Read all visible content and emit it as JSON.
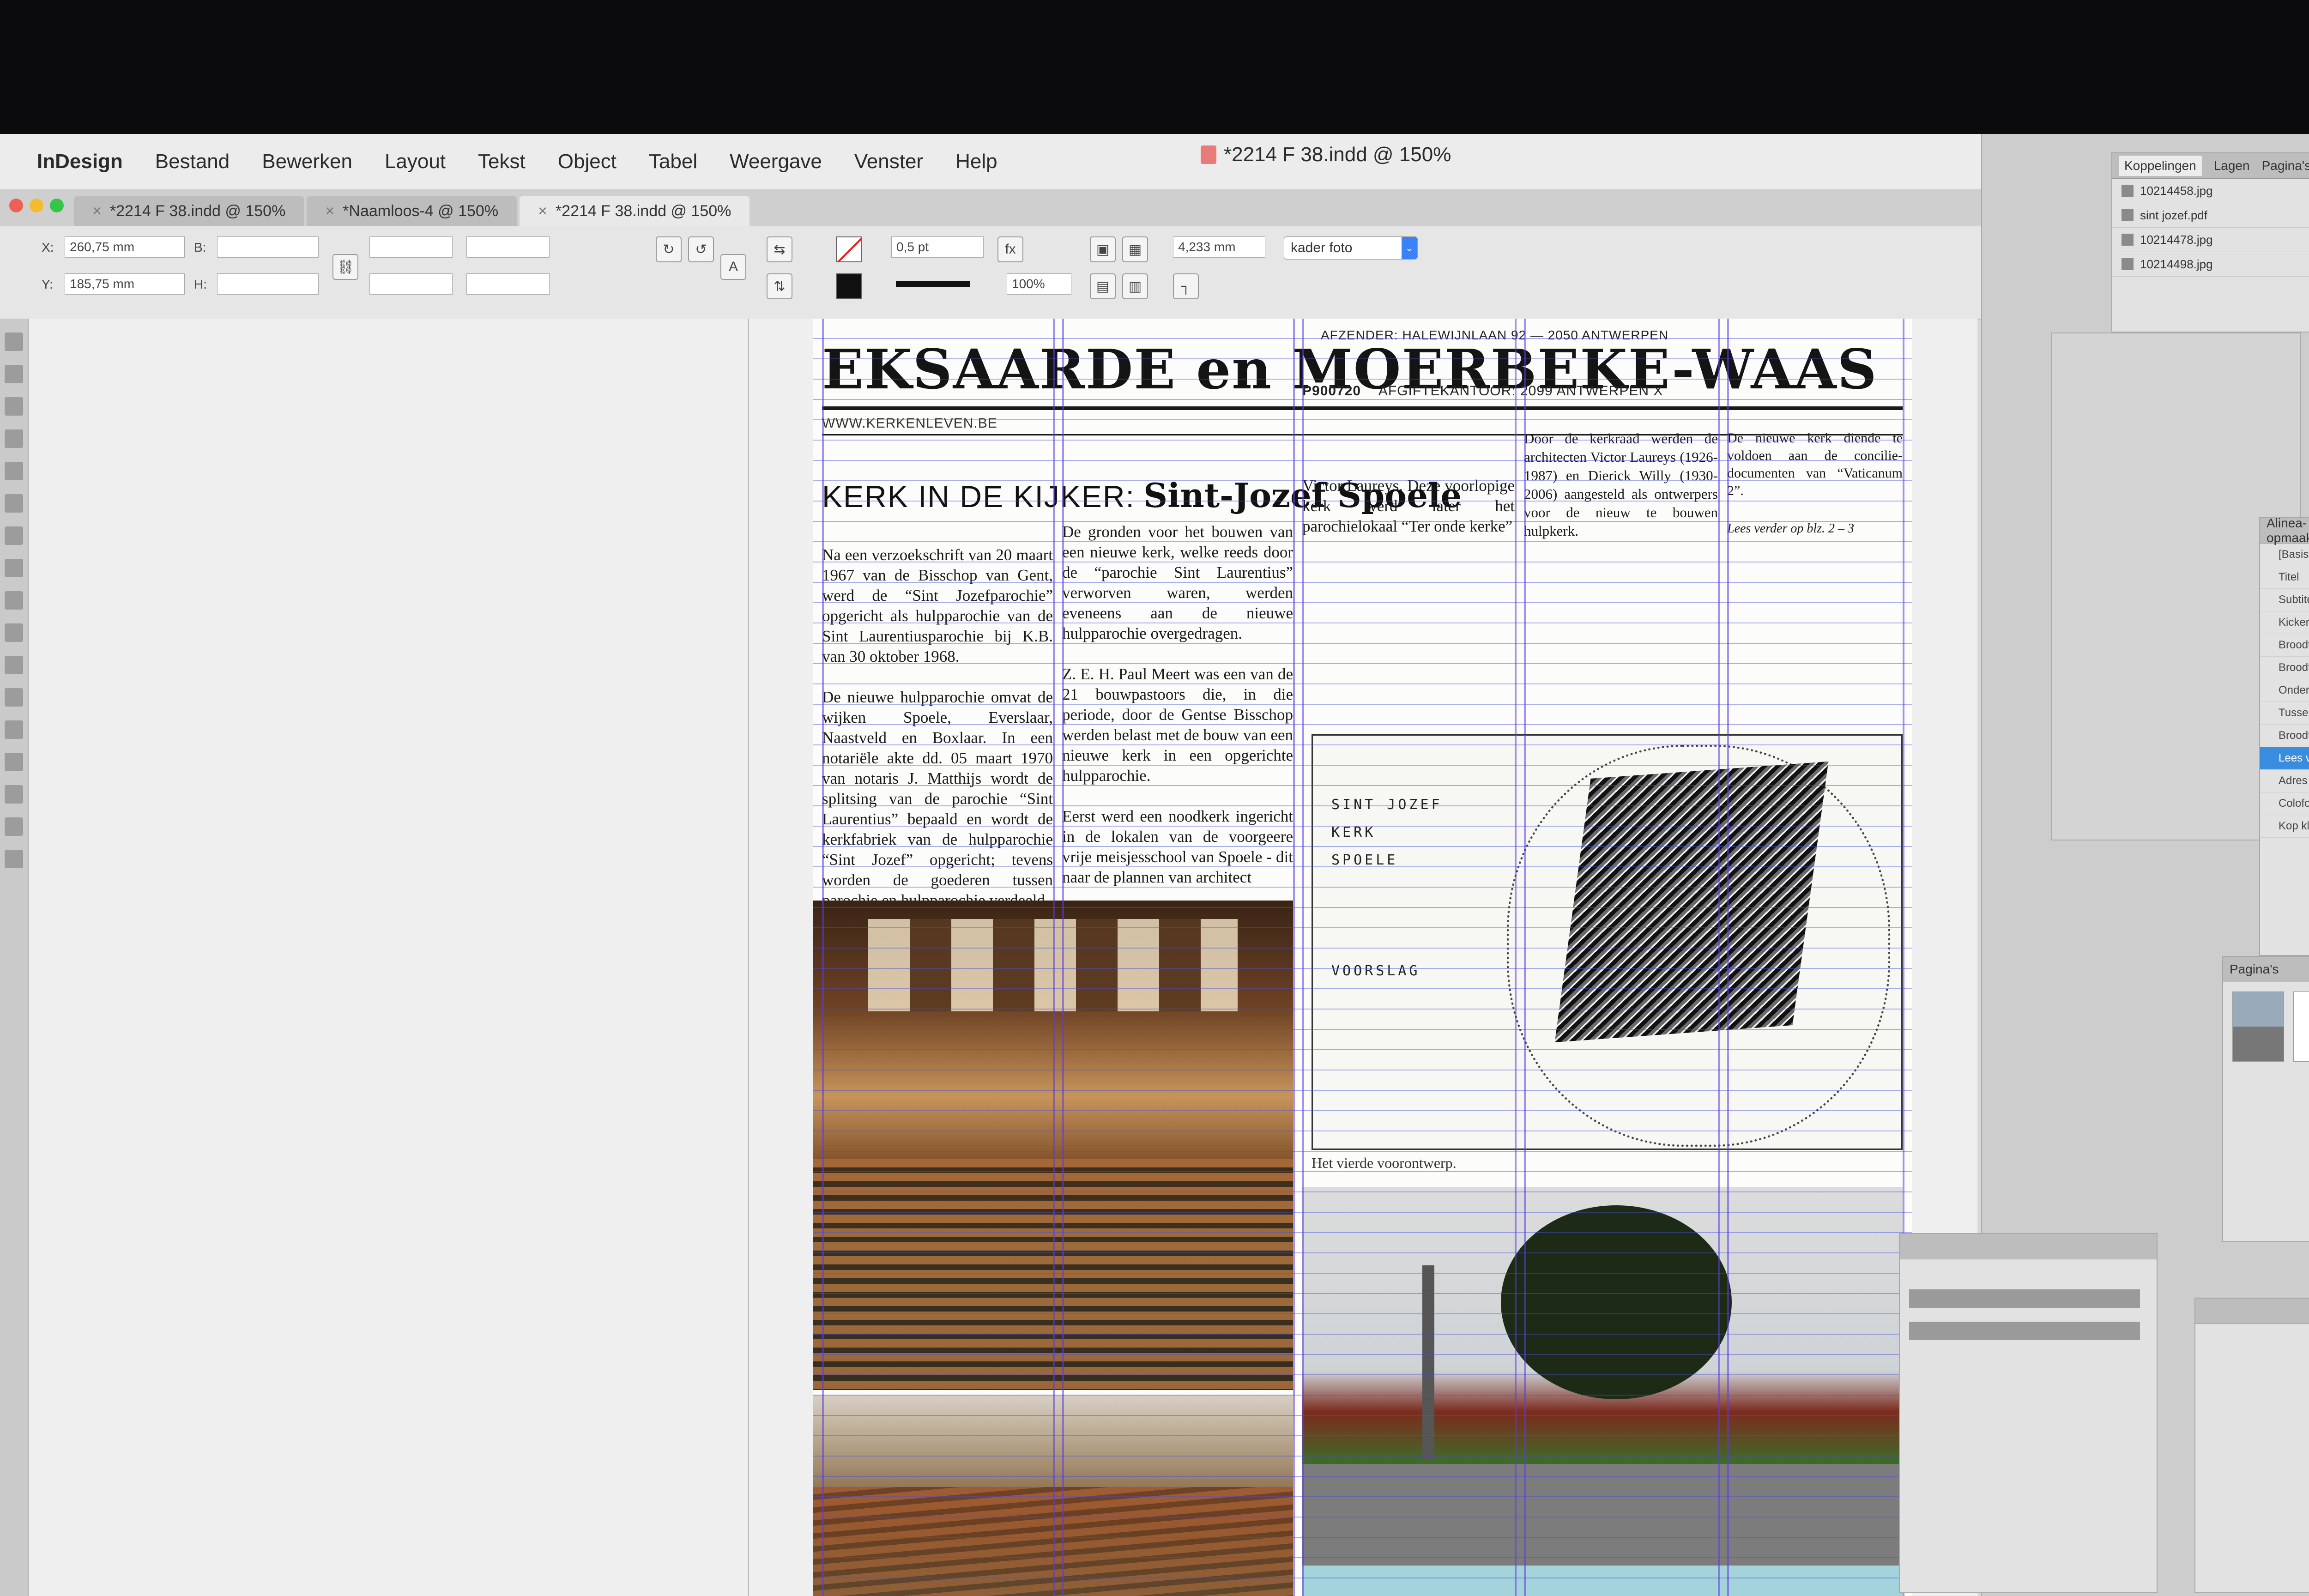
{
  "app": {
    "name": "InDesign",
    "menu": [
      "Bestand",
      "Bewerken",
      "Layout",
      "Tekst",
      "Object",
      "Tabel",
      "Weergave",
      "Venster",
      "Help"
    ],
    "window_title": "*2214 F 38.indd @ 150%"
  },
  "tabs": [
    {
      "label": "*2214 F 38.indd @ 150%",
      "active": false
    },
    {
      "label": "*Naamloos-4 @ 150%",
      "active": false
    },
    {
      "label": "*2214 F 38.indd @ 150%",
      "active": true
    }
  ],
  "control_panel": {
    "x_label": "X:",
    "x_value": "260,75 mm",
    "y_label": "Y:",
    "y_value": "185,75 mm",
    "w_label": "B:",
    "h_label": "H:",
    "stroke_weight": "0,5 pt",
    "opacity": "100%",
    "dimension": "4,233 mm",
    "object_style": "kader foto"
  },
  "document": {
    "masthead": "EKSAARDE en MOERBEKE-WAAS",
    "sender_line": "AFZENDER: HALEWIJNLAAN 92 — 2050 ANTWERPEN",
    "post_code": "P900720",
    "post_office": "AFGIFTEKANTOOR: 2099 ANTWERPEN X",
    "website": "WWW.KERKENLEVEN.BE",
    "kicker_label": "KERK IN DE KIJKER:",
    "kicker_title": "Sint-Jozef Spoele",
    "col1": [
      "Na een verzoekschrift van 20 maart 1967 van de Bisschop van Gent, werd de “Sint Jozefparochie” opgericht als hulpparochie van de Sint Laurentiusparochie bij K.B. van 30 oktober 1968.",
      "De nieuwe hulpparochie omvat de wijken Spoele, Everslaar, Naastveld en Boxlaar. In een notariële akte dd. 05 maart 1970 van notaris J. Matthijs wordt de splitsing van de parochie “Sint Laurentius” bepaald en wordt de kerkfabriek van de hulpparochie “Sint Jozef” opgericht; tevens worden de goederen tussen parochie en hulpparochie verdeeld."
    ],
    "col2": [
      "De gronden voor het bouwen van een nieuwe kerk, welke reeds door de “parochie Sint Laurentius” verworven waren, werden eveneens aan de nieuwe hulpparochie overgedragen.",
      "Z. E. H. Paul Meert was een van de 21 bouwpastoors die, in die periode, door de Gentse Bisschop werden belast met de bouw van een nieuwe kerk in een opgerichte hulpparochie.",
      "Eerst werd een noodkerk ingericht in de lokalen van de voorgeere vrije meisjesschool van Spoele - dit naar de plannen van architect"
    ],
    "col3": [
      "Victor Laureys. Deze voorlopige kerk werd later het parochielokaal “Ter onde kerke”"
    ],
    "col4": [
      "Door de kerkraad werden de architecten Victor Laureys (1926-1987) en Dierick Willy (1930-2006) aangesteld als ontwerpers voor de nieuw te bouwen hulpkerk."
    ],
    "col5": [
      "De nieuwe kerk diende te voldoen aan de concilie­documenten van “Vaticanum 2”."
    ],
    "col5_more": "Lees verder op blz. 2 – 3",
    "sketch_text": [
      "SINT JOZEF",
      "KERK",
      "SPOELE",
      "VOORSLAG"
    ],
    "sketch_caption": "Het vierde voorontwerp."
  },
  "panels": {
    "links_tabs": [
      "Koppelingen",
      "Lagen",
      "Pagina's"
    ],
    "links": [
      "10214458.jpg",
      "sint jozef.pdf",
      "10214478.jpg",
      "10214498.jpg"
    ],
    "para_styles_title": "Alinea-opmaakprofielen",
    "para_styles": [
      "[Basisalinea]",
      "Titel",
      "Subtitel",
      "Kicker",
      "Broodtekst",
      "Broodtekst eerste",
      "Onderschrift",
      "Tussenkop",
      "Broodtekst Blz",
      "Lees verder",
      "Adres",
      "Colofon",
      "Kop klein"
    ],
    "pages_title": "Pagina's"
  },
  "colors": {
    "guides": "#4650dc",
    "selection": "#3a8dde",
    "accent_blue": "#3b82f6"
  }
}
